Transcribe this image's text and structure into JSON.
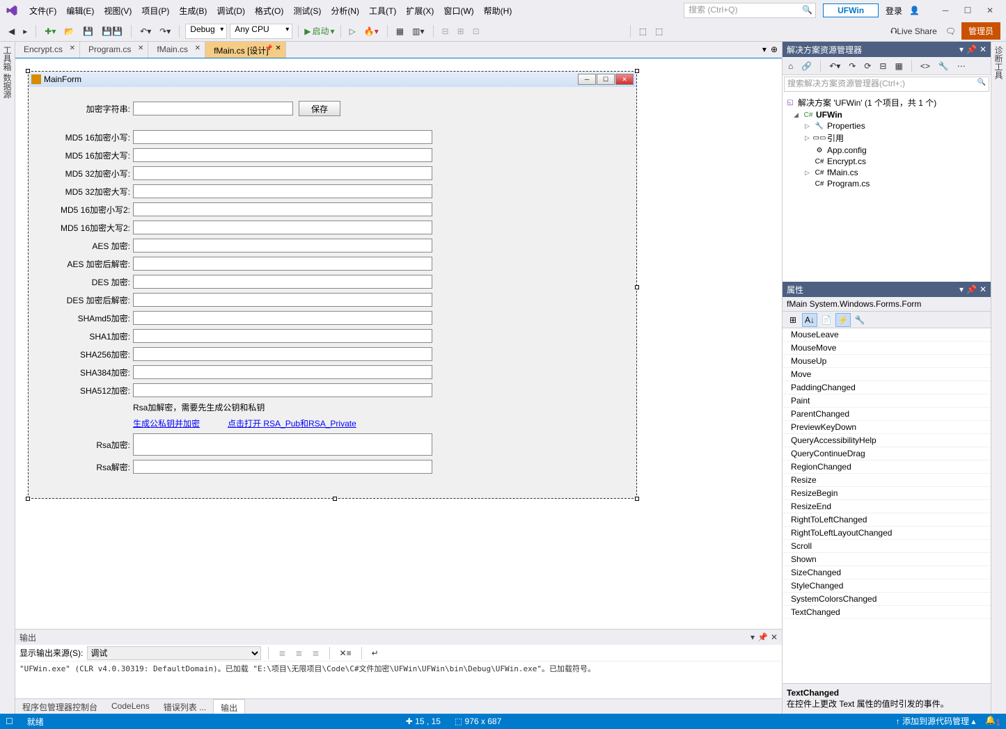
{
  "menu": [
    "文件(F)",
    "编辑(E)",
    "视图(V)",
    "项目(P)",
    "生成(B)",
    "调试(D)",
    "格式(O)",
    "测试(S)",
    "分析(N)",
    "工具(T)",
    "扩展(X)",
    "窗口(W)",
    "帮助(H)"
  ],
  "searchPlaceholder": "搜索 (Ctrl+Q)",
  "projectName": "UFWin",
  "login": "登录",
  "adminBtn": "管理员",
  "liveShare": "Live Share",
  "toolbar": {
    "config": "Debug",
    "platform": "Any CPU",
    "start": "启动"
  },
  "sideTabs": {
    "left1": "工具箱",
    "left2": "数据源",
    "right": "诊断工具"
  },
  "docTabs": [
    {
      "label": "Encrypt.cs",
      "active": false
    },
    {
      "label": "Program.cs",
      "active": false
    },
    {
      "label": "fMain.cs",
      "active": false
    },
    {
      "label": "fMain.cs [设计]",
      "active": true
    }
  ],
  "form": {
    "title": "MainForm",
    "saveBtn": "保存",
    "rows": [
      {
        "label": "加密字符串:",
        "short": true,
        "btn": true
      },
      {
        "label": "MD5 16加密小写:"
      },
      {
        "label": "MD5 16加密大写:"
      },
      {
        "label": "MD5 32加密小写:"
      },
      {
        "label": "MD5 32加密大写:"
      },
      {
        "label": "MD5 16加密小写2:"
      },
      {
        "label": "MD5 16加密大写2:"
      },
      {
        "label": "AES 加密:"
      },
      {
        "label": "AES 加密后解密:"
      },
      {
        "label": "DES 加密:"
      },
      {
        "label": "DES 加密后解密:"
      },
      {
        "label": "SHAmd5加密:"
      },
      {
        "label": "SHA1加密:"
      },
      {
        "label": "SHA256加密:"
      },
      {
        "label": "SHA384加密:"
      },
      {
        "label": "SHA512加密:"
      }
    ],
    "rsaNote": "Rsa加解密，需要先生成公钥和私钥",
    "rsaLink1": "生成公私钥并加密",
    "rsaLink2": "点击打开 RSA_Pub和RSA_Private",
    "rsaEnc": "Rsa加密:",
    "rsaDec": "Rsa解密:"
  },
  "output": {
    "title": "输出",
    "sourceLabel": "显示输出来源(S):",
    "source": "调试",
    "text": "\"UFWin.exe\" (CLR v4.0.30319: DefaultDomain)。已加载 \"E:\\项目\\无限项目\\Code\\C#文件加密\\UFWin\\UFWin\\bin\\Debug\\UFWin.exe\"。已加载符号。"
  },
  "bottomTabs": [
    "程序包管理器控制台",
    "CodeLens",
    "错误列表 ...",
    "输出"
  ],
  "solutionExplorer": {
    "title": "解决方案资源管理器",
    "searchPlaceholder": "搜索解决方案资源管理器(Ctrl+;)",
    "solutionLabel": "解决方案 'UFWin' (1 个项目，共 1 个)",
    "projectLabel": "UFWin",
    "nodes": [
      "Properties",
      "引用",
      "App.config",
      "Encrypt.cs",
      "fMain.cs",
      "Program.cs"
    ]
  },
  "properties": {
    "title": "属性",
    "object": "fMain  System.Windows.Forms.Form",
    "events": [
      "MouseLeave",
      "MouseMove",
      "MouseUp",
      "Move",
      "PaddingChanged",
      "Paint",
      "ParentChanged",
      "PreviewKeyDown",
      "QueryAccessibilityHelp",
      "QueryContinueDrag",
      "RegionChanged",
      "Resize",
      "ResizeBegin",
      "ResizeEnd",
      "RightToLeftChanged",
      "RightToLeftLayoutChanged",
      "Scroll",
      "Shown",
      "SizeChanged",
      "StyleChanged",
      "SystemColorsChanged",
      "TextChanged"
    ],
    "descName": "TextChanged",
    "descText": "在控件上更改 Text 属性的值时引发的事件。"
  },
  "status": {
    "ready": "就绪",
    "pos": "15 , 15",
    "size": "976 x 687",
    "scm": "添加到源代码管理"
  }
}
